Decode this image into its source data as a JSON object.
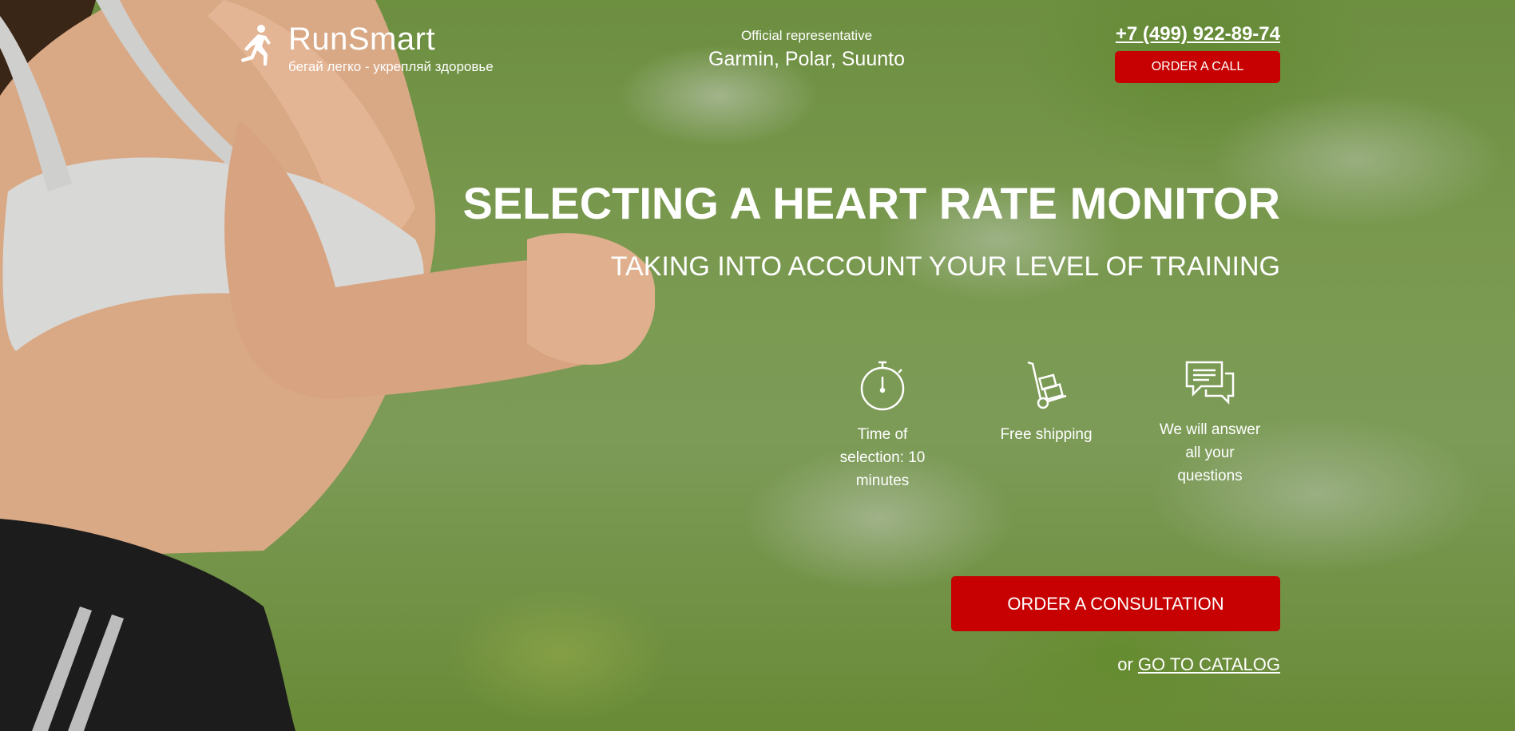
{
  "logo": {
    "name": "RunSmart",
    "tagline": "бегай легко - укрепляй здоровье",
    "icon": "runner-icon"
  },
  "representative": {
    "label": "Official representative",
    "brands": "Garmin, Polar, Suunto"
  },
  "contacts": {
    "phone": "+7 (499) 922-89-74",
    "order_call_label": "ORDER A CALL"
  },
  "hero": {
    "title": "SELECTING A HEART RATE MONITOR",
    "subtitle": "TAKING INTO ACCOUNT YOUR LEVEL OF TRAINING"
  },
  "features": [
    {
      "icon": "stopwatch-icon",
      "text": "Time of selection: 10 minutes"
    },
    {
      "icon": "hand-truck-icon",
      "text": "Free shipping"
    },
    {
      "icon": "chat-bubbles-icon",
      "text": "We will answer all your questions"
    }
  ],
  "cta": {
    "consultation_label": "ORDER A CONSULTATION",
    "or_text": "or",
    "catalog_label": "GO TO CATALOG"
  },
  "colors": {
    "accent": "#c70101",
    "text": "#ffffff"
  }
}
